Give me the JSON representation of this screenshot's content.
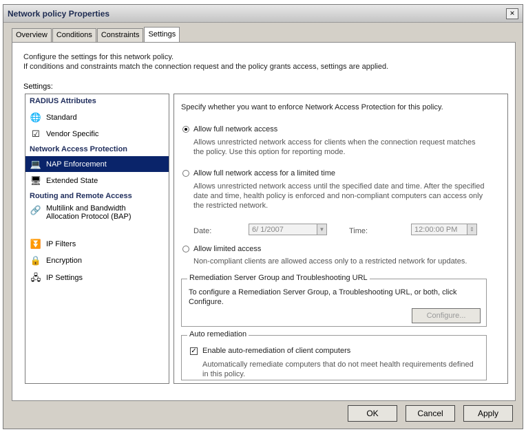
{
  "window": {
    "title": "Network policy Properties",
    "close": "×"
  },
  "tabs": [
    "Overview",
    "Conditions",
    "Constraints",
    "Settings"
  ],
  "description": {
    "line1": "Configure the settings for this network policy.",
    "line2": "If conditions and constraints match the connection request and the policy grants access, settings are applied."
  },
  "settings_label": "Settings:",
  "tree": {
    "radius_header": "RADIUS Attributes",
    "standard": "Standard",
    "vendor_specific": "Vendor Specific",
    "nap_header": "Network Access Protection",
    "nap_enforcement": "NAP Enforcement",
    "extended_state": "Extended State",
    "routing_header": "Routing and Remote Access",
    "multilink_1": "Multilink and Bandwidth",
    "multilink_2": "Allocation Protocol (BAP)",
    "ip_filters": "IP Filters",
    "encryption": "Encryption",
    "ip_settings": "IP Settings"
  },
  "nap": {
    "intro": "Specify whether you want to enforce Network Access Protection for this policy.",
    "full_access": {
      "label": "Allow full network access",
      "desc1": "Allows unrestricted network access for clients when the connection request matches",
      "desc2": "the policy. Use this option for reporting mode."
    },
    "limited_time": {
      "label": "Allow full network access for a limited time",
      "desc1": "Allows unrestricted network access until the specified date and time. After the specified",
      "desc2": "date and time, health policy is enforced and non-compliant computers can access only",
      "desc3": "the restricted network."
    },
    "date_label": "Date:",
    "date_value": "6/ 1/2007",
    "time_label": "Time:",
    "time_value": "12:00:00 PM",
    "limited_access": {
      "label": "Allow limited access",
      "desc": "Non-compliant clients are allowed access only to a restricted network for updates."
    },
    "remediation": {
      "title": "Remediation Server Group and Troubleshooting URL",
      "desc1": "To configure a Remediation Server Group, a Troubleshooting URL, or both, click",
      "desc2": "Configure.",
      "configure_button": "Configure..."
    },
    "auto": {
      "title": "Auto remediation",
      "checkbox_label": "Enable auto-remediation of client computers",
      "desc1": "Automatically remediate computers that do not meet health requirements defined",
      "desc2": "in this policy."
    }
  },
  "footer": {
    "ok": "OK",
    "cancel": "Cancel",
    "apply": "Apply"
  }
}
